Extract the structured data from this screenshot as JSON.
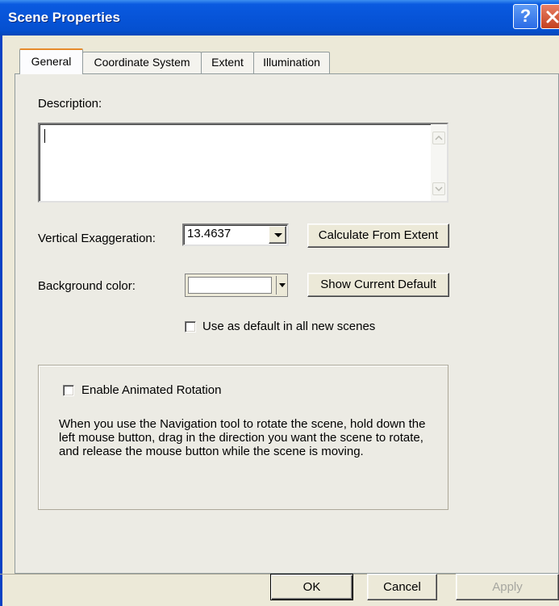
{
  "window": {
    "title": "Scene Properties",
    "help_glyph": "?",
    "icons": [
      "help-icon",
      "close-icon"
    ]
  },
  "tabs": [
    {
      "label": "General",
      "active": true
    },
    {
      "label": "Coordinate System",
      "active": false
    },
    {
      "label": "Extent",
      "active": false
    },
    {
      "label": "Illumination",
      "active": false
    }
  ],
  "general": {
    "description_label": "Description:",
    "description_value": "",
    "vertical_exaggeration_label": "Vertical Exaggeration:",
    "vertical_exaggeration_value": "13.4637",
    "calculate_button": "Calculate From Extent",
    "background_color_label": "Background color:",
    "background_color_value": "#ffffff",
    "show_default_button": "Show Current Default",
    "use_default_label": "Use as default in all new scenes",
    "use_default_checked": false
  },
  "animation": {
    "enable_label": "Enable Animated Rotation",
    "enable_checked": false,
    "description": "When you use the Navigation tool to rotate the scene, hold down the left mouse button, drag in the direction you want the scene to rotate, and release the mouse button while the scene is moving."
  },
  "buttons": {
    "ok": "OK",
    "cancel": "Cancel",
    "apply": "Apply"
  },
  "colors": {
    "titlebar": "#0754d8",
    "dialog_bg": "#ece9d8",
    "active_tab_accent": "#e68b2c"
  }
}
